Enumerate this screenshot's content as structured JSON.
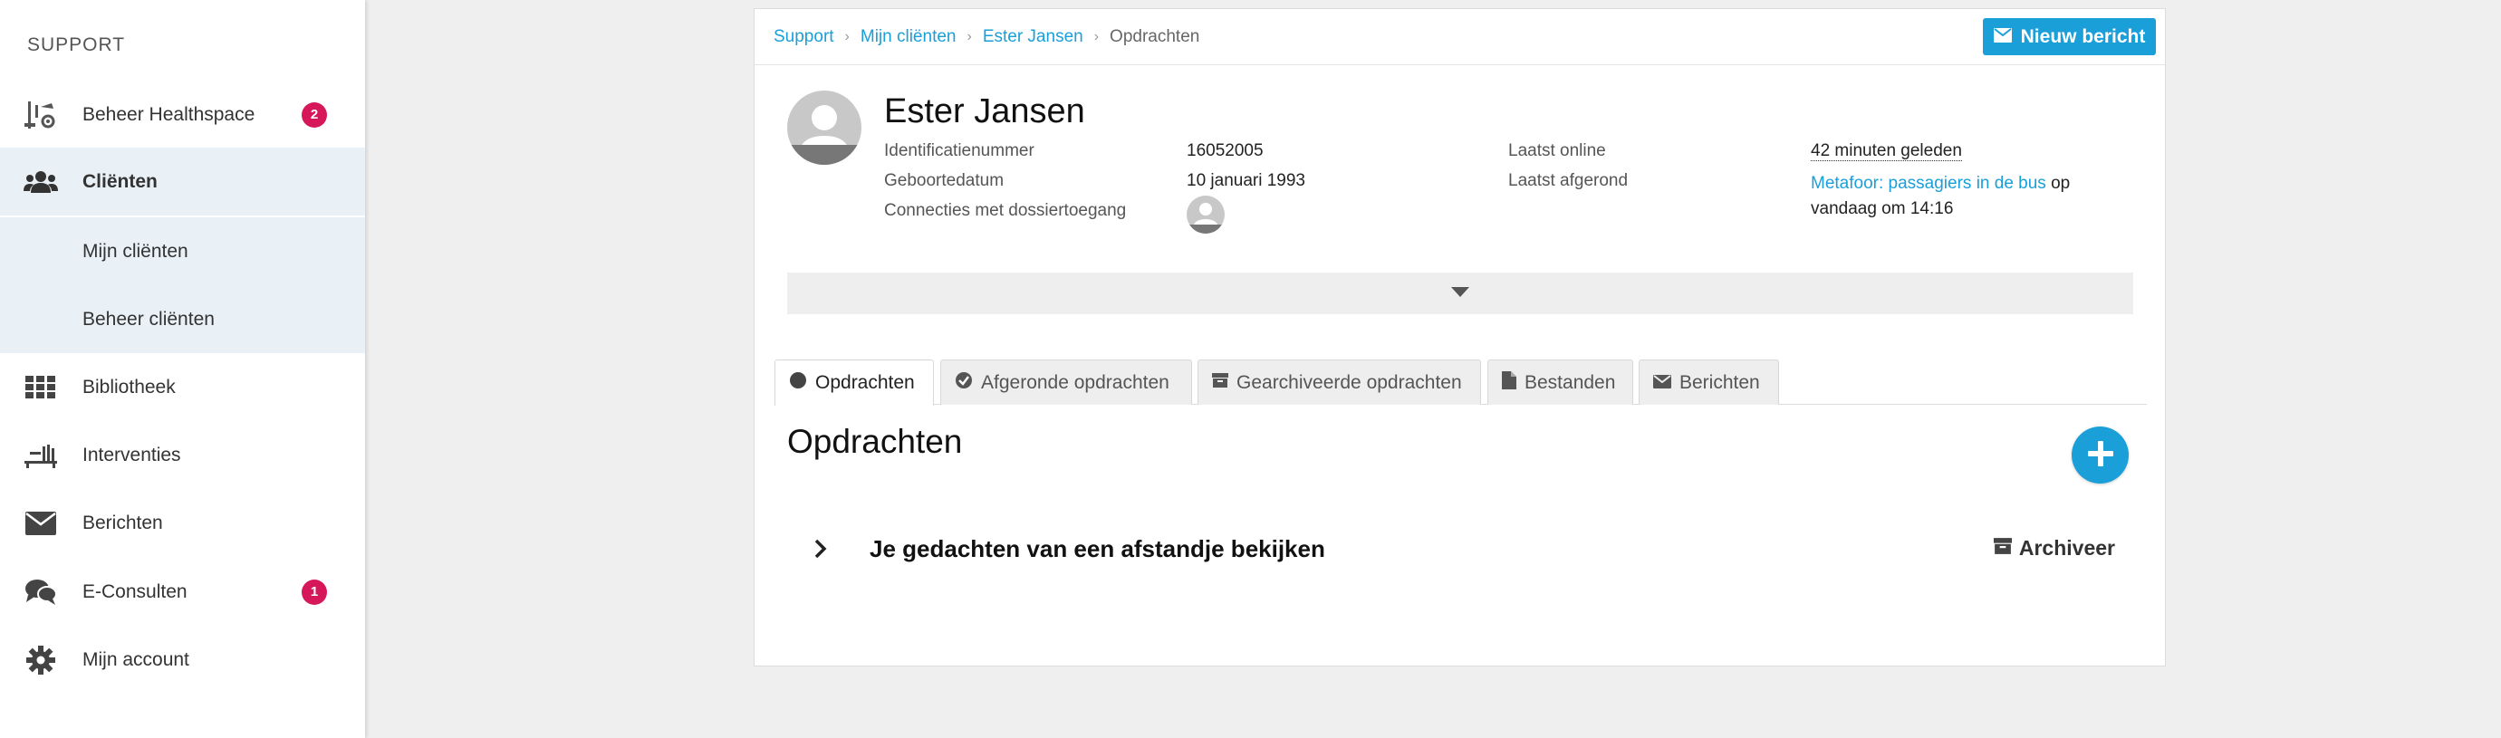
{
  "sidebar": {
    "heading": "SUPPORT",
    "items": [
      {
        "label": "Beheer Healthspace",
        "icon": "scale-gear-icon",
        "badge": "2"
      },
      {
        "label": "Cliënten",
        "icon": "users-icon"
      },
      {
        "label": "Mijn cliënten"
      },
      {
        "label": "Beheer cliënten"
      },
      {
        "label": "Bibliotheek",
        "icon": "grid-icon"
      },
      {
        "label": "Interventies",
        "icon": "interventions-icon"
      },
      {
        "label": "Berichten",
        "icon": "envelope-icon"
      },
      {
        "label": "E-Consulten",
        "icon": "chat-icon",
        "badge": "1"
      },
      {
        "label": "Mijn account",
        "icon": "gear-icon"
      }
    ]
  },
  "breadcrumb": {
    "items": [
      "Support",
      "Mijn cliënten",
      "Ester Jansen"
    ],
    "current": "Opdrachten"
  },
  "header": {
    "new_message_label": "Nieuw bericht"
  },
  "client": {
    "name": "Ester Jansen",
    "id_label": "Identificatienummer",
    "id_value": "16052005",
    "dob_label": "Geboortedatum",
    "dob_value": "10 januari 1993",
    "connections_label": "Connecties met dossiertoegang",
    "last_online_label": "Laatst online",
    "last_online_value": "42 minuten geleden",
    "last_completed_label": "Laatst afgerond",
    "last_completed_link": "Metafoor: passagiers in de bus",
    "last_completed_suffix": "op",
    "last_completed_time": "vandaag om 14:16"
  },
  "tabs": [
    {
      "label": "Opdrachten",
      "icon": "circle-icon",
      "active": true
    },
    {
      "label": "Afgeronde opdrachten",
      "icon": "check-circle-icon"
    },
    {
      "label": "Gearchiveerde opdrachten",
      "icon": "archive-icon"
    },
    {
      "label": "Bestanden",
      "icon": "file-icon"
    },
    {
      "label": "Berichten",
      "icon": "envelope-icon"
    }
  ],
  "section": {
    "title": "Opdrachten"
  },
  "assignments": [
    {
      "title": "Je gedachten van een afstandje bekijken",
      "action": "Archiveer"
    }
  ],
  "colors": {
    "accent": "#1a9fd9",
    "badge": "#d6185b",
    "active_nav_bg": "#e9f1f7"
  }
}
